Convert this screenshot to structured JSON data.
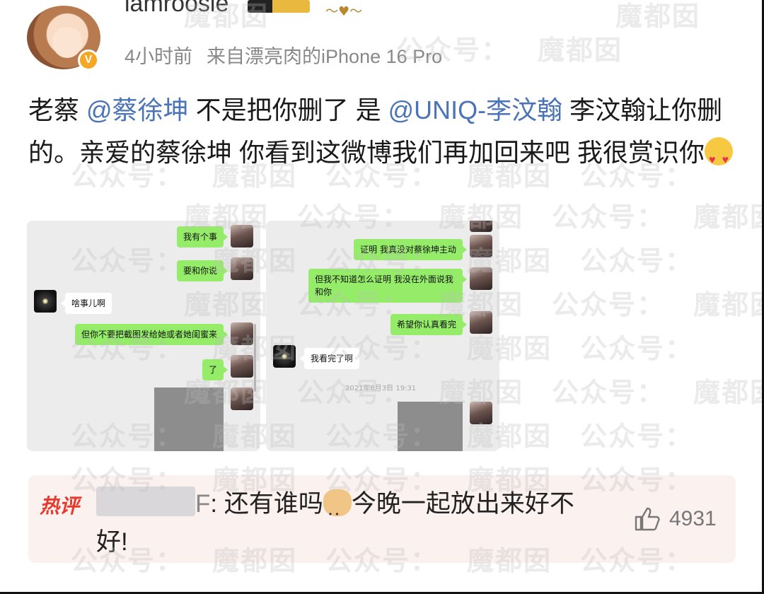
{
  "post": {
    "username": "iamroosie",
    "vip_badge": "V",
    "time_ago": "4小时前",
    "source": "来自漂亮肉的iPhone 16 Pro",
    "text_segments": [
      {
        "t": "老蔡 "
      },
      {
        "t": "@蔡徐坤",
        "mention": true
      },
      {
        "t": " 不是把你删了 是 "
      },
      {
        "t": "@UNIQ-李汶翰",
        "mention": true
      },
      {
        "t": " 李汶翰让你删的。亲爱的蔡徐坤 你看到这微博我们再加回来吧 我很赏识你"
      }
    ],
    "text_emoji": "heart-eyes-emoji"
  },
  "screenshots": {
    "left": {
      "messages": [
        {
          "side": "right",
          "text": "我有个事"
        },
        {
          "side": "right",
          "text": "要和你说"
        },
        {
          "side": "left",
          "text": "啥事儿啊"
        },
        {
          "side": "right",
          "text": "但你不要把截图发给她或者她闺蜜来"
        },
        {
          "side": "right",
          "text": "了"
        }
      ]
    },
    "right": {
      "messages": [
        {
          "side": "right",
          "text": "证明 我真没对蔡徐坤主动"
        },
        {
          "side": "right",
          "text": "但我不知道怎么证明 我没在外面说我和你"
        },
        {
          "side": "right",
          "text": "希望你认真看完"
        },
        {
          "side": "left",
          "text": "我看完了啊"
        }
      ],
      "timestamp": "2021年6月3日 19:31"
    }
  },
  "hot_comment": {
    "tag": "热评",
    "name_tail": "F",
    "text_before_emoji": ": 还有谁吗",
    "text_after_emoji": "今晚一起放出来好不好!",
    "emoji": "dog-face-emoji",
    "likes": "4931"
  },
  "watermark": {
    "text_a": "公众号：",
    "text_b": "魔都囡"
  },
  "colors": {
    "mention": "#4b73b8",
    "hot_tag": "#e8392c",
    "wechat_green": "#95ec69",
    "badge_orange": "#f5a623"
  }
}
